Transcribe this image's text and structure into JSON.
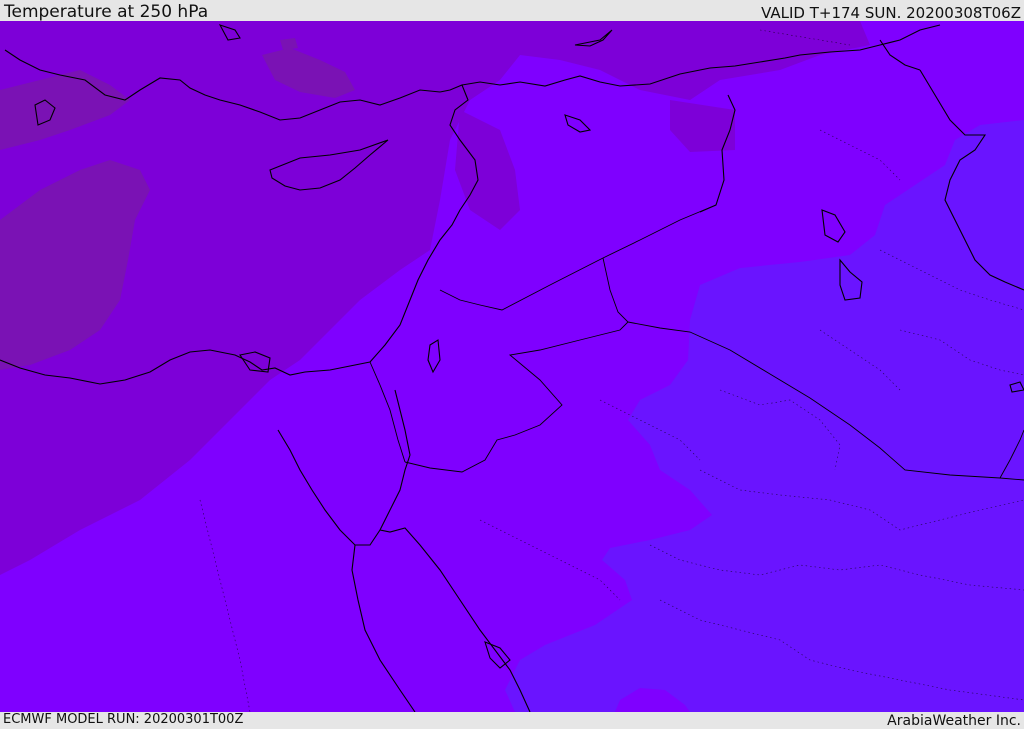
{
  "header": {
    "title": "Temperature at 250 hPa",
    "valid": "VALID T+174 SUN. 20200308T06Z"
  },
  "footer": {
    "model_run": "ECMWF MODEL RUN: 20200301T00Z",
    "credit": "ArabiaWeather Inc."
  },
  "colors": {
    "band_coldest": "#7a12b4",
    "band_cold": "#7d00d8",
    "band_mid": "#7f00ff",
    "band_warm": "#6a14ff",
    "coastline": "#000000",
    "border": "#000000"
  }
}
